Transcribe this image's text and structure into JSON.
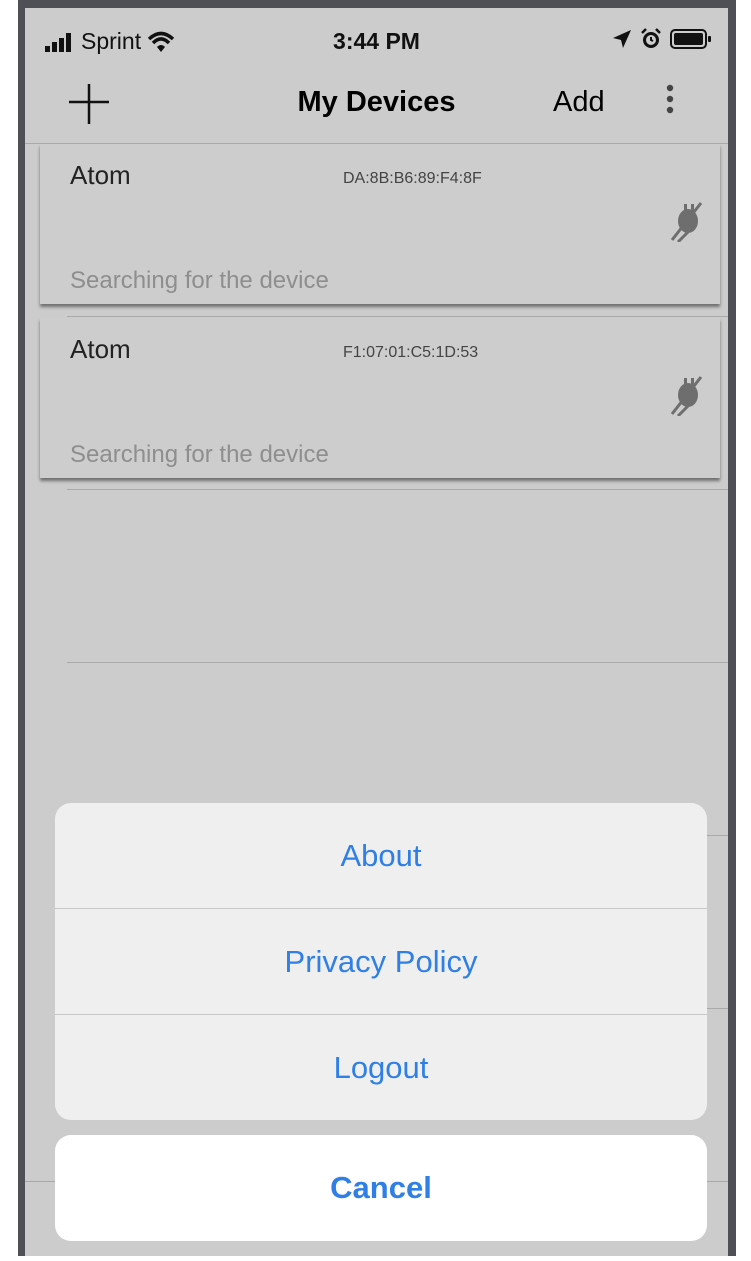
{
  "status_bar": {
    "carrier": "Sprint",
    "time": "3:44 PM",
    "icons": [
      "signal-icon",
      "wifi-icon",
      "location-icon",
      "alarm-icon",
      "battery-icon"
    ]
  },
  "nav": {
    "title": "My Devices",
    "add_label": "Add",
    "left_icon": "plus-icon",
    "right_icon": "more-vertical-icon"
  },
  "devices": [
    {
      "name": "Atom",
      "mac": "DA:8B:B6:89:F4:8F",
      "status": "Searching for the device",
      "icon": "disconnected-plug-icon"
    },
    {
      "name": "Atom",
      "mac": "F1:07:01:C5:1D:53",
      "status": "Searching for the device",
      "icon": "disconnected-plug-icon"
    }
  ],
  "action_sheet": {
    "items": [
      "About",
      "Privacy Policy",
      "Logout"
    ],
    "cancel_label": "Cancel"
  },
  "colors": {
    "accent": "#2f7fe6",
    "background": "#cccccc",
    "frame": "#4e5055"
  }
}
